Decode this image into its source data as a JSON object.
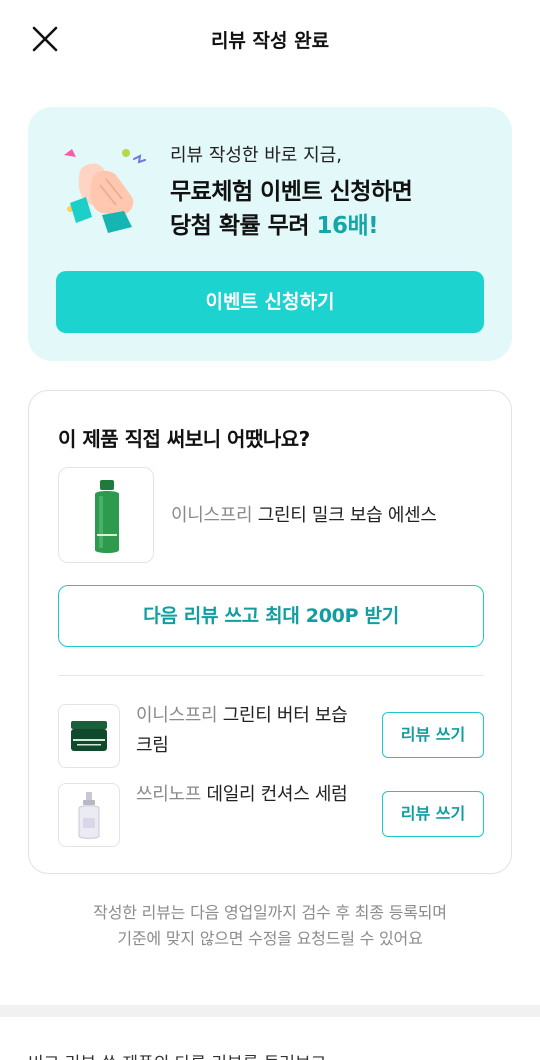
{
  "header": {
    "title": "리뷰 작성 완료",
    "close_icon": "close-icon"
  },
  "promo": {
    "subtitle": "리뷰 작성한 바로 지금,",
    "headline_line1": "무료체험 이벤트 신청하면",
    "headline_line2_prefix": "당첨 확률 무려 ",
    "headline_line2_accent": "16배!",
    "button_label": "이벤트 신청하기",
    "illustration": "clapping-hands-icon",
    "accent_color": "#1cd3cf",
    "background_color": "#e3f8f8"
  },
  "review_card": {
    "title": "이 제품 직접 써보니 어땠나요?",
    "main_product": {
      "brand": "이니스프리",
      "name": "그린티 밀크 보습 에센스",
      "image": "green-bottle-product-image"
    },
    "next_review_button": "다음 리뷰 쓰고 최대 200P 받기",
    "other_products": [
      {
        "brand": "이니스프리",
        "name": "그린티 버터 보습 크림",
        "button": "리뷰 쓰기",
        "image": "green-jar-product-image"
      },
      {
        "brand": "쓰리노프",
        "name": "데일리 컨셔스 세럼",
        "button": "리뷰 쓰기",
        "image": "clear-serum-bottle-product-image"
      }
    ]
  },
  "notice": {
    "line1": "작성한 리뷰는 다음 영업일까지 검수 후 최종 등록되며",
    "line2": "기준에 맞지 않으면 수정을 요청드릴 수 있어요"
  },
  "bottom": {
    "partial_text": "비교 리뷰 쓴 제품의 다른 리뷰를 둘러보고"
  }
}
